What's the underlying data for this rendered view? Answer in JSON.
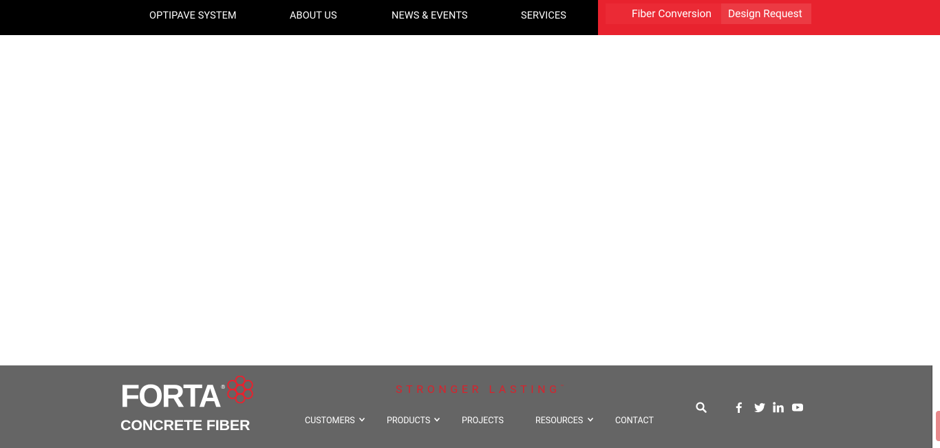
{
  "topnav": {
    "items": [
      "OPTIPAVE SYSTEM",
      "ABOUT US",
      "NEWS & EVENTS",
      "SERVICES"
    ],
    "cta_fiber": "Fiber Conversion",
    "cta_design": "Design Request"
  },
  "footer": {
    "logo_word": "FORTA",
    "logo_reg": "®",
    "logo_sub": "CONCRETE FIBER",
    "tagline": "STRONGER LASTING",
    "tagline_tm": "™",
    "nav": [
      "CUSTOMERS",
      "PRODUCTS",
      "PROJECTS",
      "RESOURCES",
      "CONTACT"
    ],
    "icons": [
      "search-icon",
      "facebook-icon",
      "twitter-icon",
      "linkedin-icon",
      "youtube-icon"
    ]
  },
  "colors": {
    "topbar": "#000000",
    "accent_red": "#e8222e",
    "footer_bg": "#656565",
    "tagline": "#d8222c"
  }
}
